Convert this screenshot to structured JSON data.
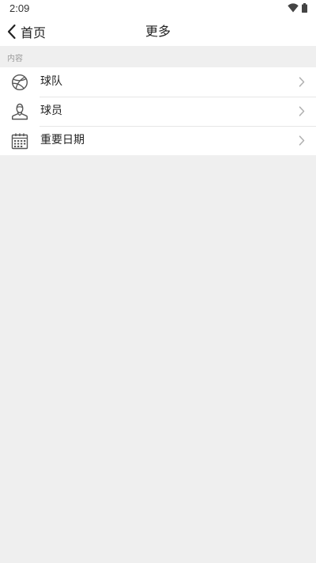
{
  "status_bar": {
    "time": "2:09"
  },
  "nav": {
    "back_label": "首页",
    "title": "更多"
  },
  "section": {
    "label": "内容"
  },
  "items": [
    {
      "label": "球队",
      "icon": "basketball-icon"
    },
    {
      "label": "球员",
      "icon": "player-icon"
    },
    {
      "label": "重要日期",
      "icon": "calendar-icon"
    }
  ],
  "colors": {
    "background": "#efefef",
    "surface": "#ffffff",
    "text": "#222222",
    "muted": "#9a9a9a",
    "chevron": "#b0b0b0",
    "icon": "#555555"
  }
}
